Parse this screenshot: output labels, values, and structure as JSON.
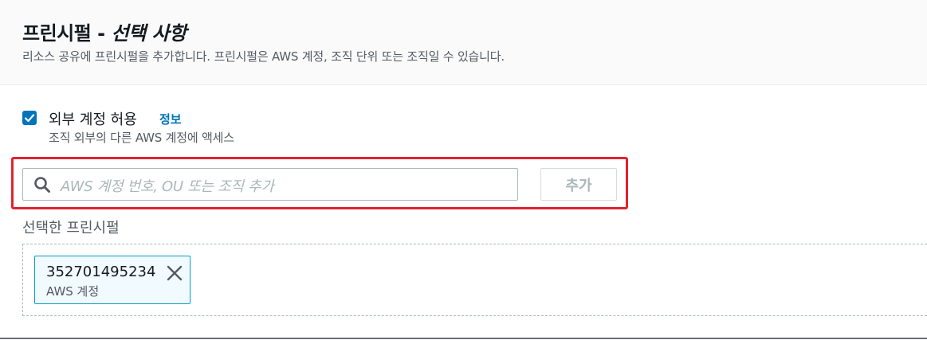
{
  "header": {
    "title": "프린시펄 - ",
    "title_optional": "선택 사항",
    "description": "리소스 공유에 프린시펄을 추가합니다. 프린시펄은 AWS 계정, 조직 단위 또는 조직일 수 있습니다."
  },
  "external_access": {
    "checked": true,
    "label": "외부 계정 허용",
    "info_link": "정보",
    "description": "조직 외부의 다른 AWS 계정에 액세스"
  },
  "search": {
    "placeholder": "AWS 계정 번호, OU 또는 조직 추가",
    "value": "",
    "icon": "search-icon"
  },
  "add_button_label": "추가",
  "selected_principals": {
    "label": "선택한 프린시펄",
    "items": [
      {
        "id": "352701495234",
        "type": "AWS 계정"
      }
    ]
  },
  "colors": {
    "accent": "#0073bb",
    "highlight": "#e0232e",
    "token_border": "#00a1c9",
    "token_background": "#f1faff"
  }
}
